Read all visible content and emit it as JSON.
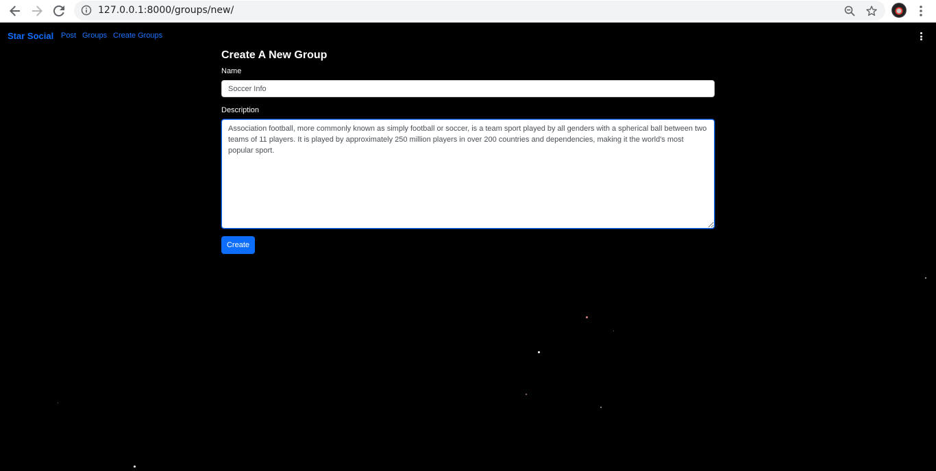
{
  "browser": {
    "url": "127.0.0.1:8000/groups/new/",
    "icons": {
      "back": "arrow-left-icon",
      "forward": "arrow-right-icon",
      "reload": "reload-icon",
      "info": "info-icon",
      "zoom": "zoom-out-icon",
      "bookmark": "star-icon",
      "menu": "kebab-menu-icon"
    }
  },
  "navbar": {
    "brand": "Star Social",
    "links": [
      "Post",
      "Groups",
      "Create Groups"
    ],
    "brand_color": "#0d6efd"
  },
  "form": {
    "title": "Create A New Group",
    "name_label": "Name",
    "name_value": "Soccer Info",
    "description_label": "Description",
    "description_value": "Association football, more commonly known as simply football or soccer, is a team sport played by all genders with a spherical ball between two teams of 11 players. It is played by approximately 250 million players in over 200 countries and dependencies, making it the world's most popular sport.",
    "submit_label": "Create",
    "accent_color": "#0d6efd"
  }
}
